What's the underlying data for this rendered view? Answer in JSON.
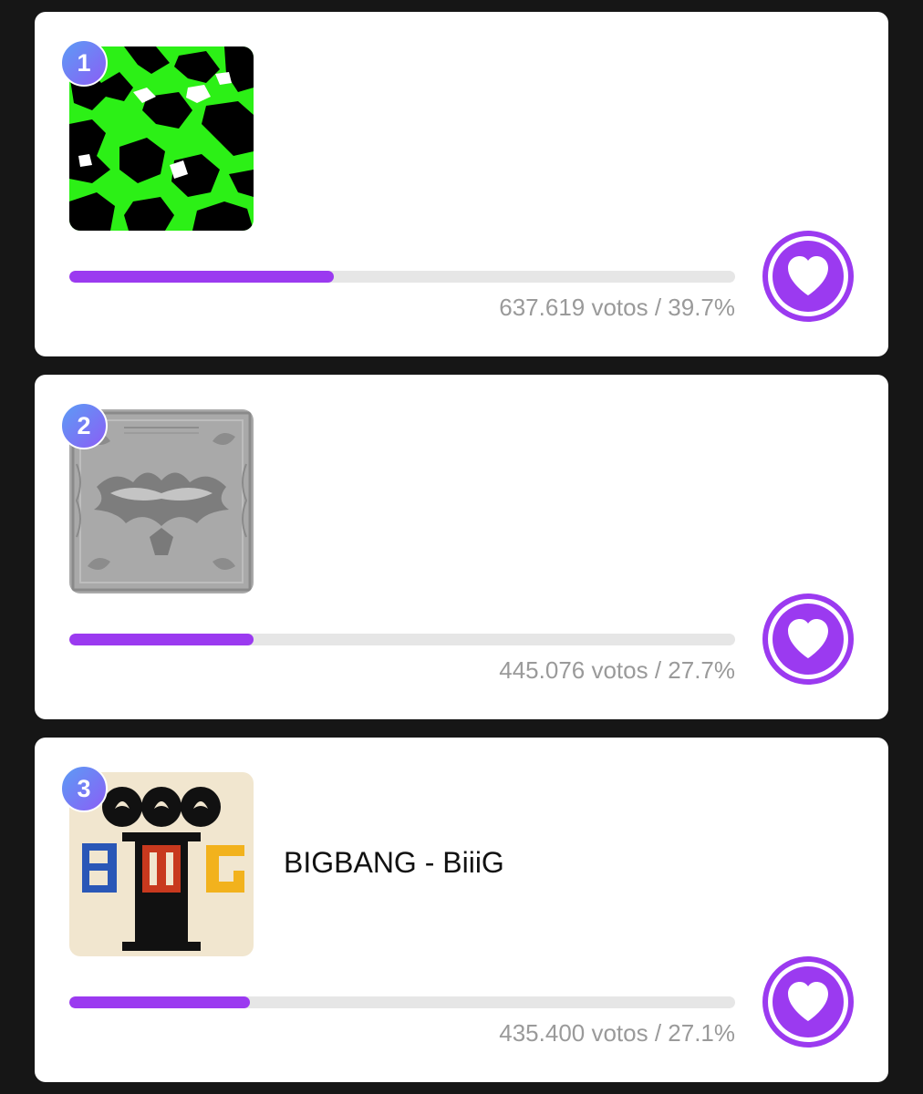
{
  "colors": {
    "accent": "#9b3af0",
    "badge_gradient_start": "#5c9cf5",
    "badge_gradient_end": "#8b5ef5",
    "background": "#161616",
    "track": "#e6e6e6",
    "vote_text": "#9a9a9a"
  },
  "entries": [
    {
      "rank": "1",
      "title": "",
      "vote_text": "637.619 votos / 39.7%",
      "progress_percent": 39.7,
      "cover_icon": "green-camo-album-cover"
    },
    {
      "rank": "2",
      "title": "",
      "vote_text": "445.076 votos / 27.7%",
      "progress_percent": 27.7,
      "cover_icon": "silver-embossed-album-cover"
    },
    {
      "rank": "3",
      "title": "BIGBANG - BiiiG",
      "vote_text": "435.400 votos / 27.1%",
      "progress_percent": 27.1,
      "cover_icon": "biiig-album-cover"
    }
  ],
  "vote_button_icon": "heart-icon"
}
